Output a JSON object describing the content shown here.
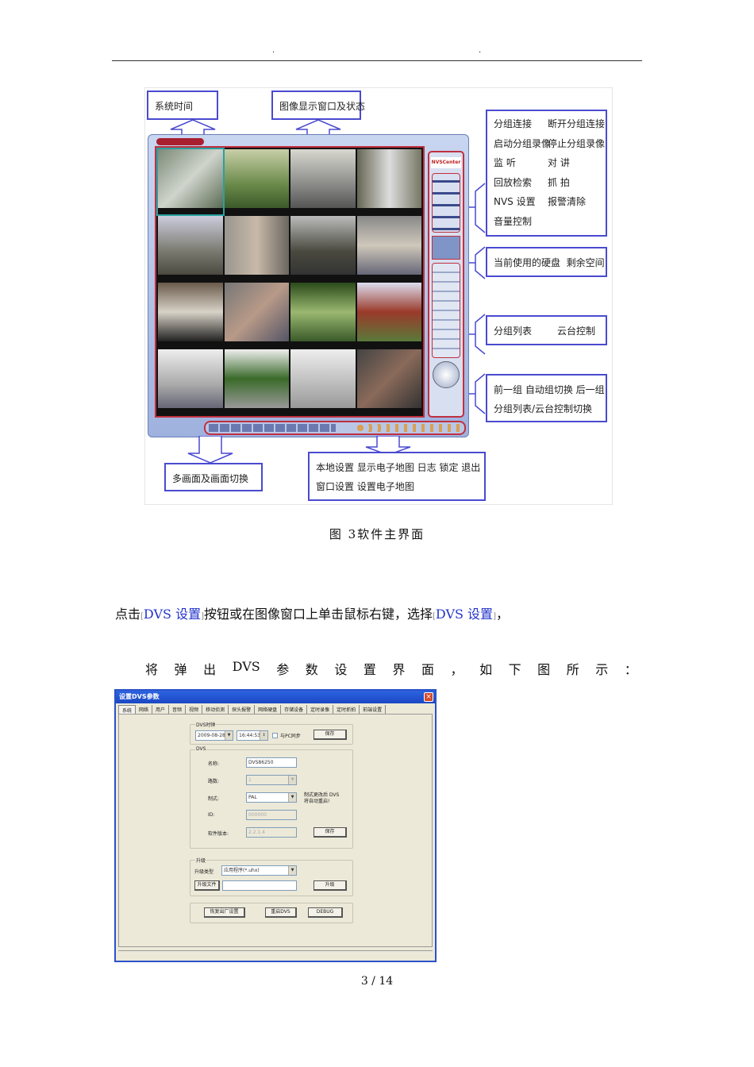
{
  "header": {
    "left_mark": ".",
    "right_mark": "."
  },
  "figure3": {
    "annotations": {
      "system_time": "系统时间",
      "image_window": "图像显示窗口及状态",
      "group_controls": [
        [
          "分组连接",
          "断开分组连接"
        ],
        [
          "启动分组录像",
          "停止分组录像"
        ],
        [
          "监 听",
          "对 讲"
        ],
        [
          "回放检索",
          "抓 拍"
        ],
        [
          "NVS 设置",
          "报警清除"
        ],
        [
          "音量控制",
          ""
        ]
      ],
      "disk": [
        "当前使用的硬盘",
        "剩余空间"
      ],
      "list_ptz": [
        "分组列表",
        "云台控制"
      ],
      "group_switch": [
        "前一组  自动组切换  后一组",
        "分组列表/云台控制切换"
      ],
      "multi_screen": "多画面及画面切换",
      "bottom_buttons": [
        "本地设置  显示电子地图  日志  锁定  退出",
        "窗口设置  设置电子地图"
      ]
    },
    "app_logo": "NVSCenter",
    "caption": "图 3软件主界面"
  },
  "paragraph": {
    "p1_a": "点击",
    "p1_link1": "DVS 设置",
    "p1_b": "按钮或在图像窗口上单击鼠标右键，选择",
    "p1_link2": "DVS 设置",
    "p1_c": "，",
    "p2": [
      "将",
      "弹",
      "出",
      "DVS",
      "参",
      "数",
      "设",
      "置",
      "界",
      "面",
      "，",
      "如",
      "下",
      "图",
      "所",
      "示",
      "："
    ]
  },
  "dialog": {
    "title": "设置DVS参数",
    "close": "×",
    "tabs": [
      "系统",
      "网络",
      "用户",
      "音频",
      "视频",
      "移动侦测",
      "探头报警",
      "网络硬盘",
      "存储设备",
      "定时录像",
      "定时抓拍",
      "前端设置"
    ],
    "clock_group": "DVS时钟",
    "date": "2009-08-28",
    "time": "16:44:53",
    "sync_pc": "与PC同步",
    "save": "保存",
    "dvs_group": "DVS",
    "name_label": "名称:",
    "name_value": "DVS86250",
    "channels_label": "路数:",
    "channels_value": "1",
    "format_label": "制式:",
    "format_value": "PAL",
    "format_note": [
      "制式更改后 DVS",
      "将自动重启!"
    ],
    "id_label": "ID:",
    "id_value": "000000",
    "version_label": "软件版本:",
    "version_value": "2.2.1.4",
    "save2": "保存",
    "upgrade_group": "升级",
    "upgrade_type_label": "升级类型",
    "upgrade_type_value": "应用程序(*.uhx)",
    "upgrade_file_button": "升级文件",
    "upgrade_file_value": "",
    "upgrade_button": "升级",
    "factory_reset": "恢复出厂设置",
    "reboot": "重启DVS",
    "debug": "DEBUG"
  },
  "page_number": "3 / 14"
}
